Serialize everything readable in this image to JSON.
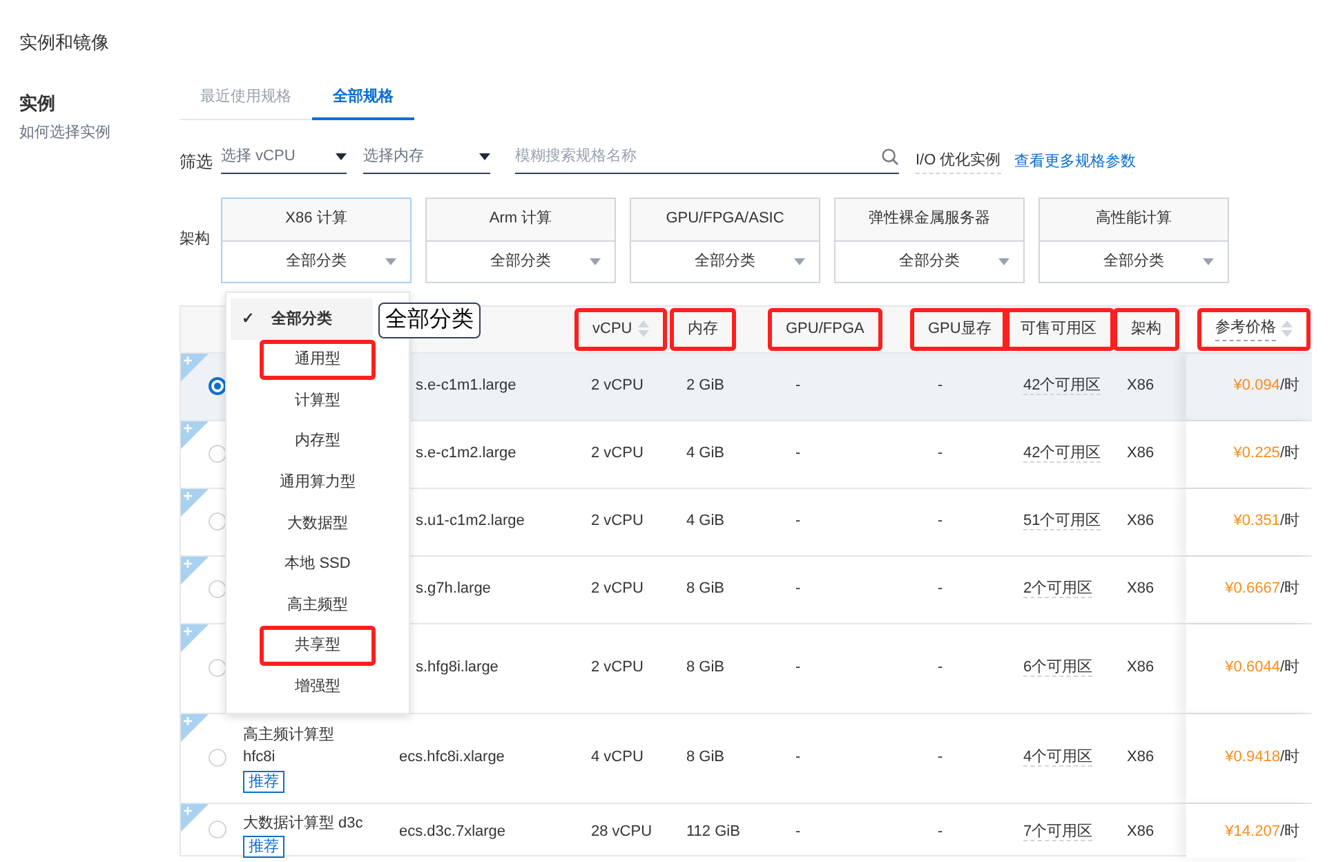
{
  "page": {
    "title": "实例和镜像"
  },
  "section": {
    "title": "实例",
    "help_link": "如何选择实例"
  },
  "tabs": [
    {
      "label": "最近使用规格",
      "selected": false
    },
    {
      "label": "全部规格",
      "selected": true
    }
  ],
  "filter": {
    "label": "筛选",
    "vcpu_select": {
      "placeholder": "选择 vCPU"
    },
    "memory_select": {
      "placeholder": "选择内存"
    },
    "search": {
      "placeholder": "模糊搜索规格名称"
    },
    "io_label": "I/O 优化实例",
    "more_link": "查看更多规格参数"
  },
  "architecture": {
    "label": "架构",
    "options": [
      {
        "name": "X86 计算",
        "category": "全部分类",
        "selected": true
      },
      {
        "name": "Arm 计算",
        "category": "全部分类",
        "selected": false
      },
      {
        "name": "GPU/FPGA/ASIC",
        "category": "全部分类",
        "selected": false
      },
      {
        "name": "弹性裸金属服务器",
        "category": "全部分类",
        "selected": false
      },
      {
        "name": "高性能计算",
        "category": "全部分类",
        "selected": false
      }
    ]
  },
  "category_menu": {
    "items": [
      {
        "label": "全部分类",
        "selected": true,
        "highlighted": false
      },
      {
        "label": "通用型",
        "selected": false,
        "highlighted": true
      },
      {
        "label": "计算型",
        "selected": false,
        "highlighted": false
      },
      {
        "label": "内存型",
        "selected": false,
        "highlighted": false
      },
      {
        "label": "通用算力型",
        "selected": false,
        "highlighted": false
      },
      {
        "label": "大数据型",
        "selected": false,
        "highlighted": false
      },
      {
        "label": "本地 SSD",
        "selected": false,
        "highlighted": false
      },
      {
        "label": "高主频型",
        "selected": false,
        "highlighted": false
      },
      {
        "label": "共享型",
        "selected": false,
        "highlighted": true
      },
      {
        "label": "增强型",
        "selected": false,
        "highlighted": false
      }
    ],
    "check": "✓"
  },
  "tooltip": "全部分类",
  "table": {
    "columns": [
      {
        "label": "vCPU",
        "sortable": true,
        "highlighted": true
      },
      {
        "label": "内存",
        "sortable": false,
        "highlighted": true
      },
      {
        "label": "GPU/FPGA",
        "sortable": false,
        "highlighted": true
      },
      {
        "label": "GPU显存",
        "sortable": false,
        "highlighted": true
      },
      {
        "label": "可售可用区",
        "sortable": false,
        "highlighted": true
      },
      {
        "label": "架构",
        "sortable": false,
        "highlighted": true
      },
      {
        "label": "参考价格",
        "sortable": true,
        "highlighted": true
      }
    ],
    "rows": [
      {
        "selected": true,
        "spec": "s.e-c1m1.large",
        "vcpu": "2 vCPU",
        "memory": "2 GiB",
        "gpu": "-",
        "gpu_memory": "-",
        "zones": "42个可用区",
        "arch": "X86",
        "price": "¥0.094",
        "unit": "/时"
      },
      {
        "selected": false,
        "spec": "s.e-c1m2.large",
        "vcpu": "2 vCPU",
        "memory": "4 GiB",
        "gpu": "-",
        "gpu_memory": "-",
        "zones": "42个可用区",
        "arch": "X86",
        "price": "¥0.225",
        "unit": "/时"
      },
      {
        "selected": false,
        "spec": "s.u1-c1m2.large",
        "vcpu": "2 vCPU",
        "memory": "4 GiB",
        "gpu": "-",
        "gpu_memory": "-",
        "zones": "51个可用区",
        "arch": "X86",
        "price": "¥0.351",
        "unit": "/时"
      },
      {
        "selected": false,
        "spec": "s.g7h.large",
        "vcpu": "2 vCPU",
        "memory": "8 GiB",
        "gpu": "-",
        "gpu_memory": "-",
        "zones": "2个可用区",
        "arch": "X86",
        "price": "¥0.6667",
        "unit": "/时"
      },
      {
        "selected": false,
        "spec": "s.hfg8i.large",
        "vcpu": "2 vCPU",
        "memory": "8 GiB",
        "gpu": "-",
        "gpu_memory": "-",
        "zones": "6个可用区",
        "arch": "X86",
        "price": "¥0.6044",
        "unit": "/时",
        "tall": true
      },
      {
        "selected": false,
        "type": "高主频计算型",
        "family": "hfc8i",
        "badge": "推荐",
        "spec": "ecs.hfc8i.xlarge",
        "vcpu": "4 vCPU",
        "memory": "8 GiB",
        "gpu": "-",
        "gpu_memory": "-",
        "zones": "4个可用区",
        "arch": "X86",
        "price": "¥0.9418",
        "unit": "/时",
        "tall": true
      },
      {
        "selected": false,
        "type": "大数据计算型 d3c",
        "badge": "推荐",
        "spec": "ecs.d3c.7xlarge",
        "vcpu": "28 vCPU",
        "memory": "112 GiB",
        "gpu": "-",
        "gpu_memory": "-",
        "zones": "7个可用区",
        "arch": "X86",
        "price": "¥14.207",
        "unit": "/时",
        "last": true
      }
    ]
  }
}
